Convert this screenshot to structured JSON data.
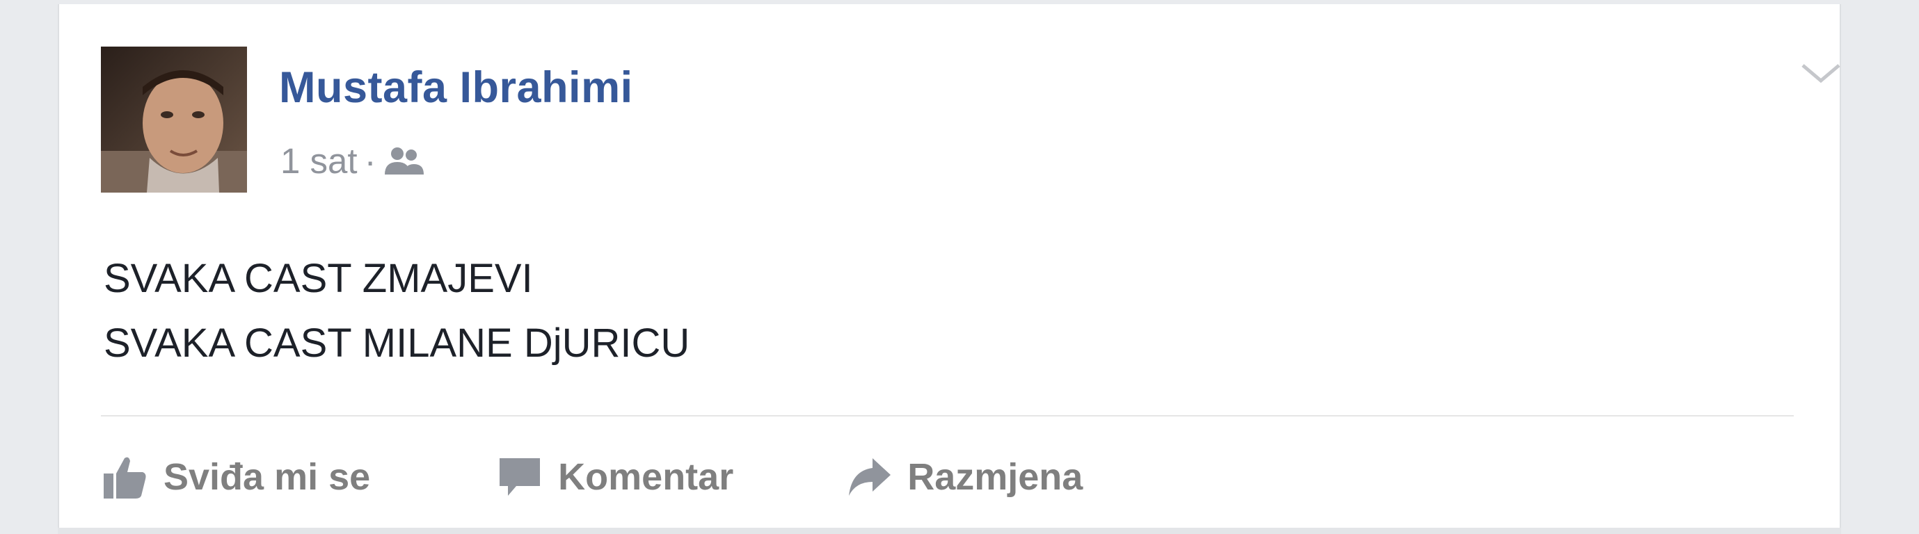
{
  "post": {
    "author": "Mustafa Ibrahimi",
    "time": "1 sat",
    "separator": "·",
    "audience_icon": "friends-icon",
    "text_lines": [
      "SVAKA CAST ZMAJEVI",
      "SVAKA CAST MILANE DjURICU"
    ]
  },
  "actions": {
    "like_label": "Sviđa mi se",
    "comment_label": "Komentar",
    "share_label": "Razmjena"
  },
  "colors": {
    "author_link": "#365899",
    "meta_text": "#90949c",
    "post_text": "#1d2129",
    "action_text": "#7f7f7f",
    "page_background": "#e9ebee"
  }
}
